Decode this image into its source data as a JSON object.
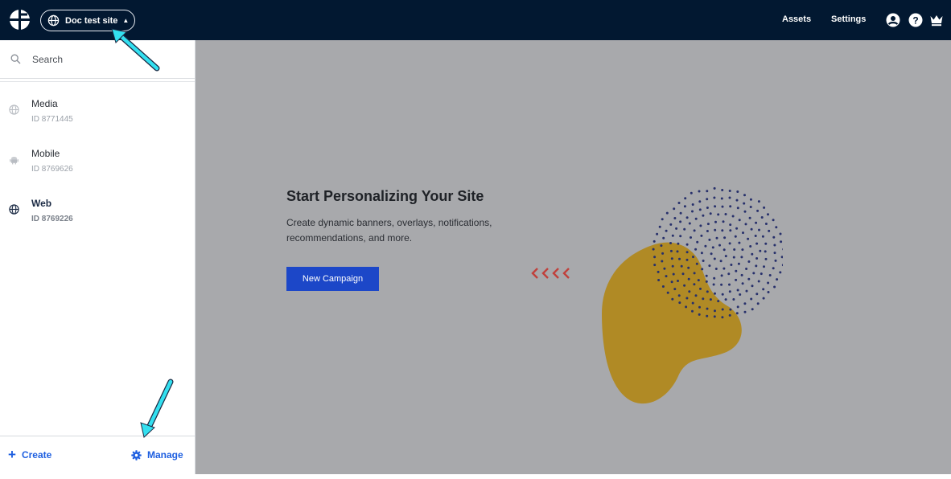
{
  "topbar": {
    "site_selector": "Doc test site",
    "links": {
      "assets": "Assets",
      "settings": "Settings"
    },
    "icons": [
      "logo-icon",
      "globe-icon",
      "caret-up-icon",
      "user-icon",
      "help-icon",
      "crown-icon"
    ]
  },
  "sidebar": {
    "search_placeholder": "Search",
    "sites": [
      {
        "name": "Media",
        "id": "ID 8771445",
        "icon": "globe-icon",
        "active": false
      },
      {
        "name": "Mobile",
        "id": "ID 8769626",
        "icon": "android-icon",
        "active": false
      },
      {
        "name": "Web",
        "id": "ID 8769226",
        "icon": "globe-icon",
        "active": true
      }
    ],
    "footer": {
      "create": "Create",
      "manage": "Manage"
    }
  },
  "main": {
    "title": "Start Personalizing Your Site",
    "description": "Create dynamic banners, overlays, notifications, recommendations, and more.",
    "cta": "New Campaign"
  },
  "colors": {
    "topbar_bg": "#021831",
    "main_bg": "#a8a9ac",
    "accent_blue": "#1c47c8",
    "link_blue": "#1e5fe0",
    "blob_gold": "#b08a25",
    "dots_navy": "#27306b",
    "chevrons_red": "#c0403c",
    "annotation_cyan": "#33e0f0"
  }
}
